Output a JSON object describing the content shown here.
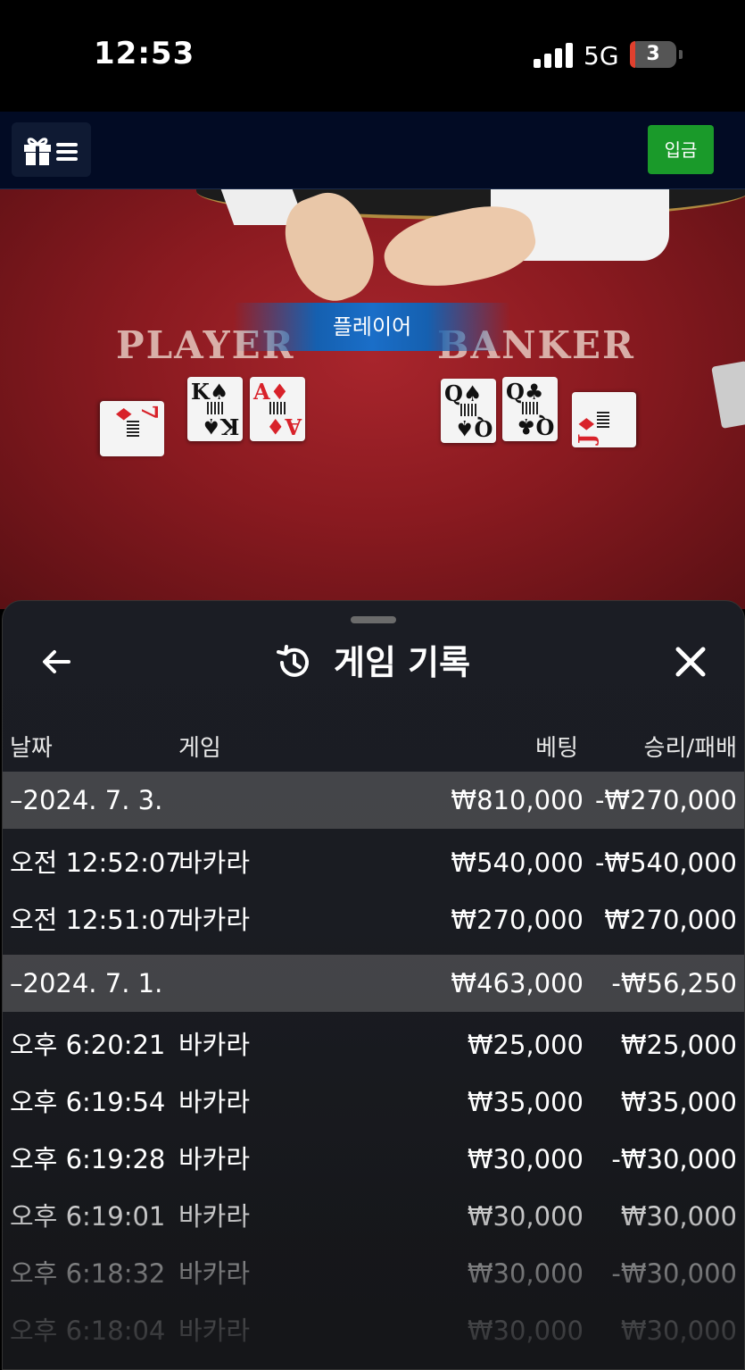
{
  "status_bar": {
    "time": "12:53",
    "network": "5G",
    "battery": "3"
  },
  "header": {
    "menu_icon": "gift-menu-icon",
    "deposit_label": "입금",
    "accent": "#1a9a2a"
  },
  "game_view": {
    "overlay_label": "플레이어",
    "player_label": "PLAYER",
    "banker_label": "BANKER",
    "player_cards": [
      {
        "rank": "7",
        "suit": "♦",
        "color": "red"
      },
      {
        "rank": "K",
        "suit": "♠",
        "color": "black"
      },
      {
        "rank": "A",
        "suit": "♦",
        "color": "red"
      }
    ],
    "banker_cards": [
      {
        "rank": "Q",
        "suit": "♠",
        "color": "black"
      },
      {
        "rank": "Q",
        "suit": "♣",
        "color": "black"
      },
      {
        "rank": "J",
        "suit": "♦",
        "color": "red"
      }
    ]
  },
  "history": {
    "title": "게임 기록",
    "columns": {
      "date": "날짜",
      "game": "게임",
      "bet": "베팅",
      "result": "승리/패배"
    },
    "rows": [
      {
        "type": "group",
        "date": "–2024. 7. 3.",
        "game": "",
        "bet": "₩810,000",
        "result": "-₩270,000"
      },
      {
        "type": "item",
        "date": "오전 12:52:07",
        "game": "바카라",
        "bet": "₩540,000",
        "result": "-₩540,000"
      },
      {
        "type": "item",
        "date": "오전 12:51:07",
        "game": "바카라",
        "bet": "₩270,000",
        "result": "₩270,000"
      },
      {
        "type": "group",
        "date": "–2024. 7. 1.",
        "game": "",
        "bet": "₩463,000",
        "result": "-₩56,250"
      },
      {
        "type": "item",
        "date": "오후 6:20:21",
        "game": "바카라",
        "bet": "₩25,000",
        "result": "₩25,000"
      },
      {
        "type": "item",
        "date": "오후 6:19:54",
        "game": "바카라",
        "bet": "₩35,000",
        "result": "₩35,000"
      },
      {
        "type": "item",
        "date": "오후 6:19:28",
        "game": "바카라",
        "bet": "₩30,000",
        "result": "-₩30,000"
      },
      {
        "type": "item",
        "date": "오후 6:19:01",
        "game": "바카라",
        "bet": "₩30,000",
        "result": "₩30,000"
      },
      {
        "type": "item",
        "date": "오후 6:18:32",
        "game": "바카라",
        "bet": "₩30,000",
        "result": "-₩30,000"
      },
      {
        "type": "item",
        "date": "오후 6:18:04",
        "game": "바카라",
        "bet": "₩30,000",
        "result": "₩30,000"
      }
    ]
  }
}
